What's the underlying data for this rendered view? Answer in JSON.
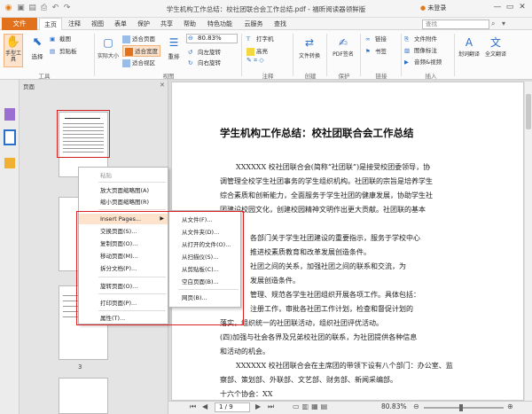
{
  "window": {
    "title": "学生机构工作总结：校社团联合会工作总结.pdf - 福昕阅读器领鲜版",
    "user": "未登录",
    "controls": [
      "—",
      "▭",
      "✕"
    ]
  },
  "menu": {
    "file": "文件",
    "tabs": [
      "主页",
      "注释",
      "视图",
      "表单",
      "保护",
      "共享",
      "帮助",
      "特色功能",
      "云服务",
      "查找"
    ],
    "search_placeholder": "查找"
  },
  "ribbon": {
    "hand_tool": "手型工具",
    "select": "选择",
    "screenshot": "截图",
    "clipboard": "剪贴板",
    "actual_size": "实际大小",
    "fit_page": "适合页面",
    "fit_width": "适合宽度",
    "fit_visible": "适合视区",
    "reflow": "重排",
    "zoom_value": "80.83%",
    "rotate_left": "向左旋转",
    "rotate_right": "向右旋转",
    "typewriter": "打字机",
    "highlight": "高亮",
    "file_convert": "文件转换",
    "pdf_sign": "PDF签名",
    "link": "链接",
    "bookmark": "书签",
    "file_attach": "文件附件",
    "image_annot": "图像标注",
    "audio_video": "音频&视频",
    "ocr": "划词翻译",
    "translate": "全文翻译",
    "groups": [
      "工具",
      "视图",
      "注释",
      "创建",
      "保护",
      "链接",
      "插入"
    ]
  },
  "panel": {
    "header": "页面",
    "page_number": "3"
  },
  "context_menu": {
    "items": [
      {
        "label": "粘贴",
        "disabled": true
      },
      {
        "label": "放大页面缩略图(A)",
        "disabled": false
      },
      {
        "label": "缩小页面缩略图(R)",
        "disabled": false
      },
      {
        "label": "Insert Pages...",
        "disabled": false,
        "submenu": true
      },
      {
        "label": "交换页面(S)...",
        "disabled": false
      },
      {
        "label": "复制页面(O)...",
        "disabled": false
      },
      {
        "label": "移动页面(M)...",
        "disabled": false
      },
      {
        "label": "拆分文档(P)...",
        "disabled": false
      },
      {
        "label": "旋转页面(O)...",
        "disabled": false
      },
      {
        "label": "打印页面(P)...",
        "disabled": false
      },
      {
        "label": "属性(T)...",
        "disabled": false
      }
    ]
  },
  "submenu": {
    "items": [
      "从文件(F)...",
      "从文件夹(D)...",
      "从打开的文件(O)...",
      "从扫描仪(S)...",
      "从剪贴板(C)...",
      "空白页面(B)...",
      "网页(B)..."
    ]
  },
  "document": {
    "title": "学生机构工作总结：校社团联合会工作总结",
    "lines": [
      "XXXXXX 校社团联合会(简称“社团联”)是接受校团委领导，协",
      "调管理全校学生社团事务的学生组织机构。社团联的宗旨是培养学生",
      "综合素质和创新能力，全面服务于学生社团的健康发展，协助学生社",
      "团建设校园文化，创建校园精神文明作出更大贡献。社团联的基本",
      "",
      "各部门关于学生社团建设的重要指示，服务于学校中心",
      "推进校素质教育和改革发展创造条件。",
      "社团之间的关系，加强社团之间的联系和交流，为",
      "发展创造条件。",
      "管理、规范各学生社团组织开展各项工作。具体包括：",
      "注册工作，审批各社团工作计划，检查和督促计划的",
      "落实，组织统一的社团联活动，组织社团评优活动。",
      "(四)加强与社会各界及兄弟校社团的联系，为社团提供各种信息",
      "和活动的机会。",
      "XXXXXX 校社团联合会在主席团的带领下设有八个部门：办公室、监",
      "察部、策划部、外联部、文艺部、财务部、新闻采编部。",
      "十六个协会：XX"
    ]
  },
  "status": {
    "page_indicator": "1 / 9",
    "zoom": "80.83%"
  }
}
